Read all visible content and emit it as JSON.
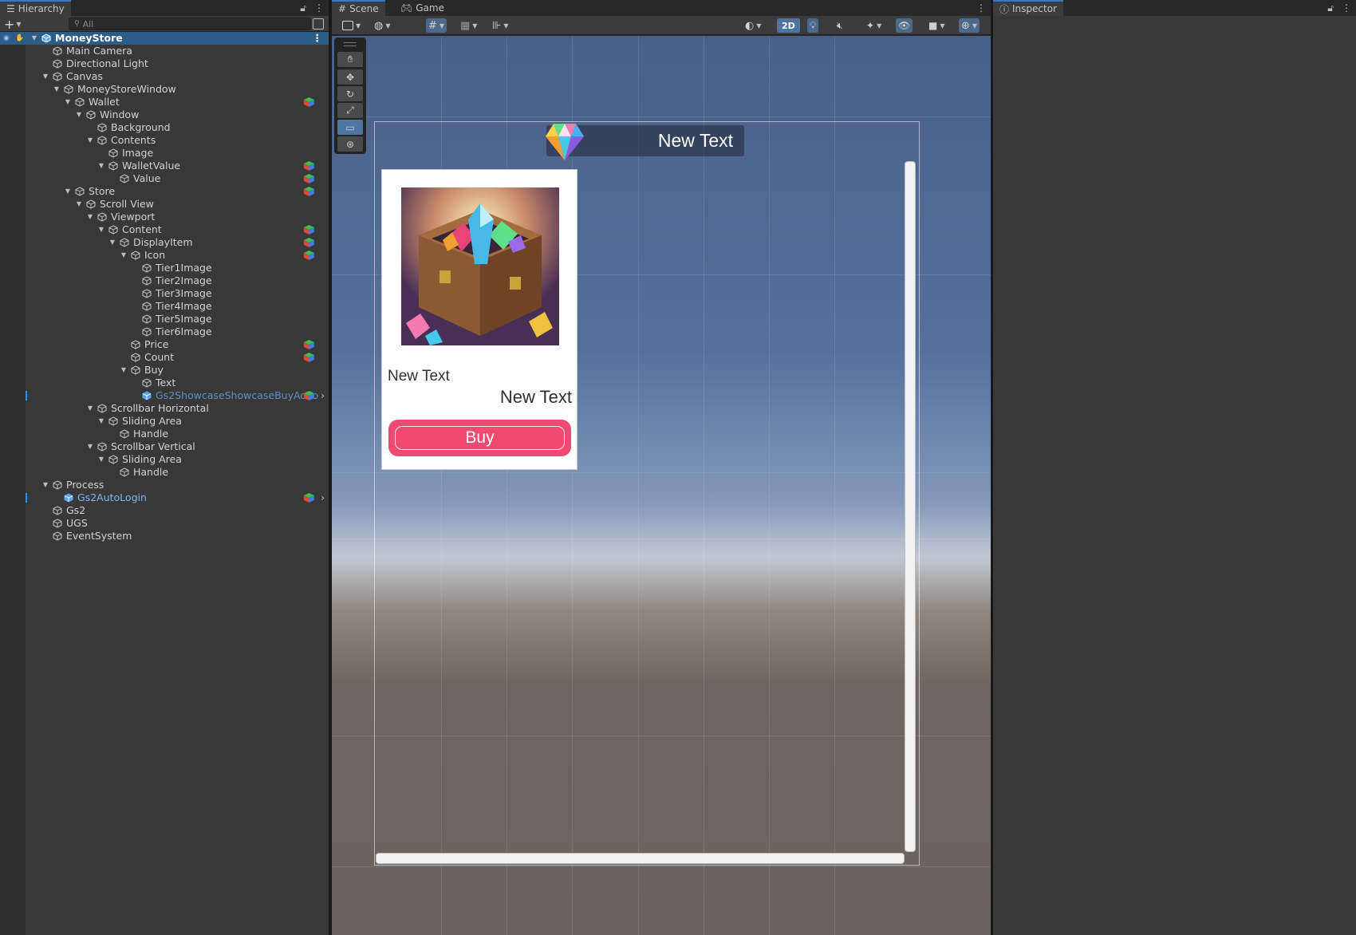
{
  "hierarchy": {
    "tab_label": "Hierarchy",
    "search_placeholder": "All",
    "rows": [
      {
        "label": "MoneyStore",
        "depth": 0,
        "expanded": true,
        "kind": "scene",
        "selected": true
      },
      {
        "label": "Main Camera",
        "depth": 1
      },
      {
        "label": "Directional Light",
        "depth": 1
      },
      {
        "label": "Canvas",
        "depth": 1,
        "expanded": true
      },
      {
        "label": "MoneyStoreWindow",
        "depth": 2,
        "expanded": true
      },
      {
        "label": "Wallet",
        "depth": 3,
        "expanded": true,
        "component": true
      },
      {
        "label": "Window",
        "depth": 4,
        "expanded": true
      },
      {
        "label": "Background",
        "depth": 5
      },
      {
        "label": "Contents",
        "depth": 5,
        "expanded": true
      },
      {
        "label": "Image",
        "depth": 6
      },
      {
        "label": "WalletValue",
        "depth": 6,
        "expanded": true,
        "component": true
      },
      {
        "label": "Value",
        "depth": 7,
        "component": true
      },
      {
        "label": "Store",
        "depth": 3,
        "expanded": true,
        "component": true
      },
      {
        "label": "Scroll View",
        "depth": 4,
        "expanded": true
      },
      {
        "label": "Viewport",
        "depth": 5,
        "expanded": true
      },
      {
        "label": "Content",
        "depth": 6,
        "expanded": true,
        "component": true
      },
      {
        "label": "DisplayItem",
        "depth": 7,
        "expanded": true,
        "component": true
      },
      {
        "label": "Icon",
        "depth": 8,
        "expanded": true,
        "component": true
      },
      {
        "label": "Tier1Image",
        "depth": 9
      },
      {
        "label": "Tier2Image",
        "depth": 9
      },
      {
        "label": "Tier3Image",
        "depth": 9
      },
      {
        "label": "Tier4Image",
        "depth": 9
      },
      {
        "label": "Tier5Image",
        "depth": 9
      },
      {
        "label": "Tier6Image",
        "depth": 9
      },
      {
        "label": "Price",
        "depth": 8,
        "component": true
      },
      {
        "label": "Count",
        "depth": 8,
        "component": true
      },
      {
        "label": "Buy",
        "depth": 8,
        "expanded": true
      },
      {
        "label": "Text",
        "depth": 9
      },
      {
        "label": "Gs2ShowcaseShowcaseBuyActio",
        "depth": 9,
        "kind": "prefab-dim",
        "component": true,
        "chevron": true,
        "marker": true
      },
      {
        "label": "Scrollbar Horizontal",
        "depth": 5,
        "expanded": true
      },
      {
        "label": "Sliding Area",
        "depth": 6,
        "expanded": true
      },
      {
        "label": "Handle",
        "depth": 7
      },
      {
        "label": "Scrollbar Vertical",
        "depth": 5,
        "expanded": true
      },
      {
        "label": "Sliding Area",
        "depth": 6,
        "expanded": true
      },
      {
        "label": "Handle",
        "depth": 7
      },
      {
        "label": "Process",
        "depth": 1,
        "expanded": true
      },
      {
        "label": "Gs2AutoLogin",
        "depth": 2,
        "kind": "prefab",
        "component": true,
        "chevron": true,
        "marker": true
      },
      {
        "label": "Gs2",
        "depth": 1
      },
      {
        "label": "UGS",
        "depth": 1
      },
      {
        "label": "EventSystem",
        "depth": 1
      }
    ]
  },
  "scene": {
    "tab_scene": "Scene",
    "tab_game": "Game",
    "toolbar_2d_label": "2D",
    "tools": [
      "hand-tool",
      "move-tool",
      "rotate-tool",
      "scale-tool",
      "rect-tool",
      "transform-tool"
    ],
    "active_tool": "rect-tool",
    "wallet_value": "New Text",
    "item_price": "New Text",
    "item_count": "New Text",
    "buy_label": "Buy"
  },
  "inspector": {
    "tab_label": "Inspector"
  },
  "colors": {
    "selection": "#2c5d87",
    "prefab_text": "#7cb4f2",
    "buy_button": "#ef4a72",
    "accent_tab": "#3a79bb"
  }
}
